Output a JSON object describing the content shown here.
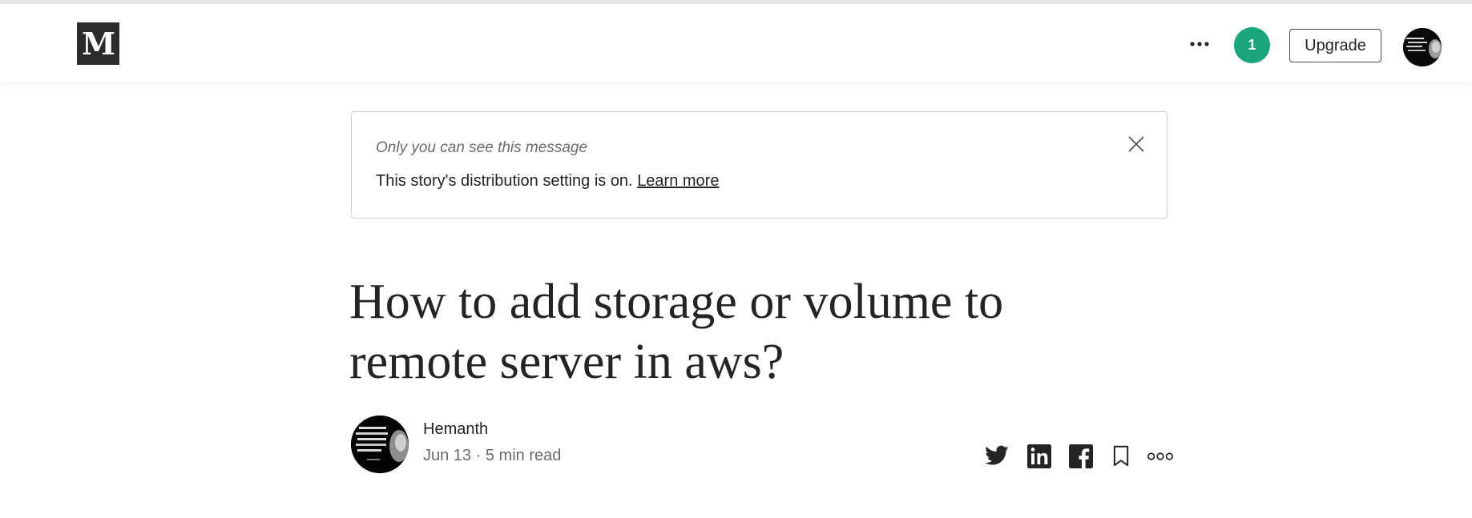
{
  "header": {
    "logo_text": "M",
    "notification_count": "1",
    "upgrade_label": "Upgrade",
    "icons": [
      "medium-logo",
      "more-options-icon",
      "user-avatar"
    ]
  },
  "notice": {
    "italic_text": "Only you can see this message",
    "text": "This story's distribution setting is on.",
    "link_text": "Learn more",
    "icons": [
      "close-icon"
    ]
  },
  "article": {
    "title_line1": "How to add storage or volume to",
    "title_line2": "remote server in aws?",
    "author": "Hemanth",
    "date": "Jun 13",
    "separator": "·",
    "read_time": "5 min read"
  },
  "share_icons": [
    "twitter-icon",
    "linkedin-icon",
    "facebook-icon",
    "bookmark-icon",
    "more-icon"
  ],
  "colors": {
    "accent_green": "#1aa67a",
    "text_primary": "#242424",
    "text_secondary": "#6b6b6b",
    "logo_bg": "#2b2b2b"
  }
}
